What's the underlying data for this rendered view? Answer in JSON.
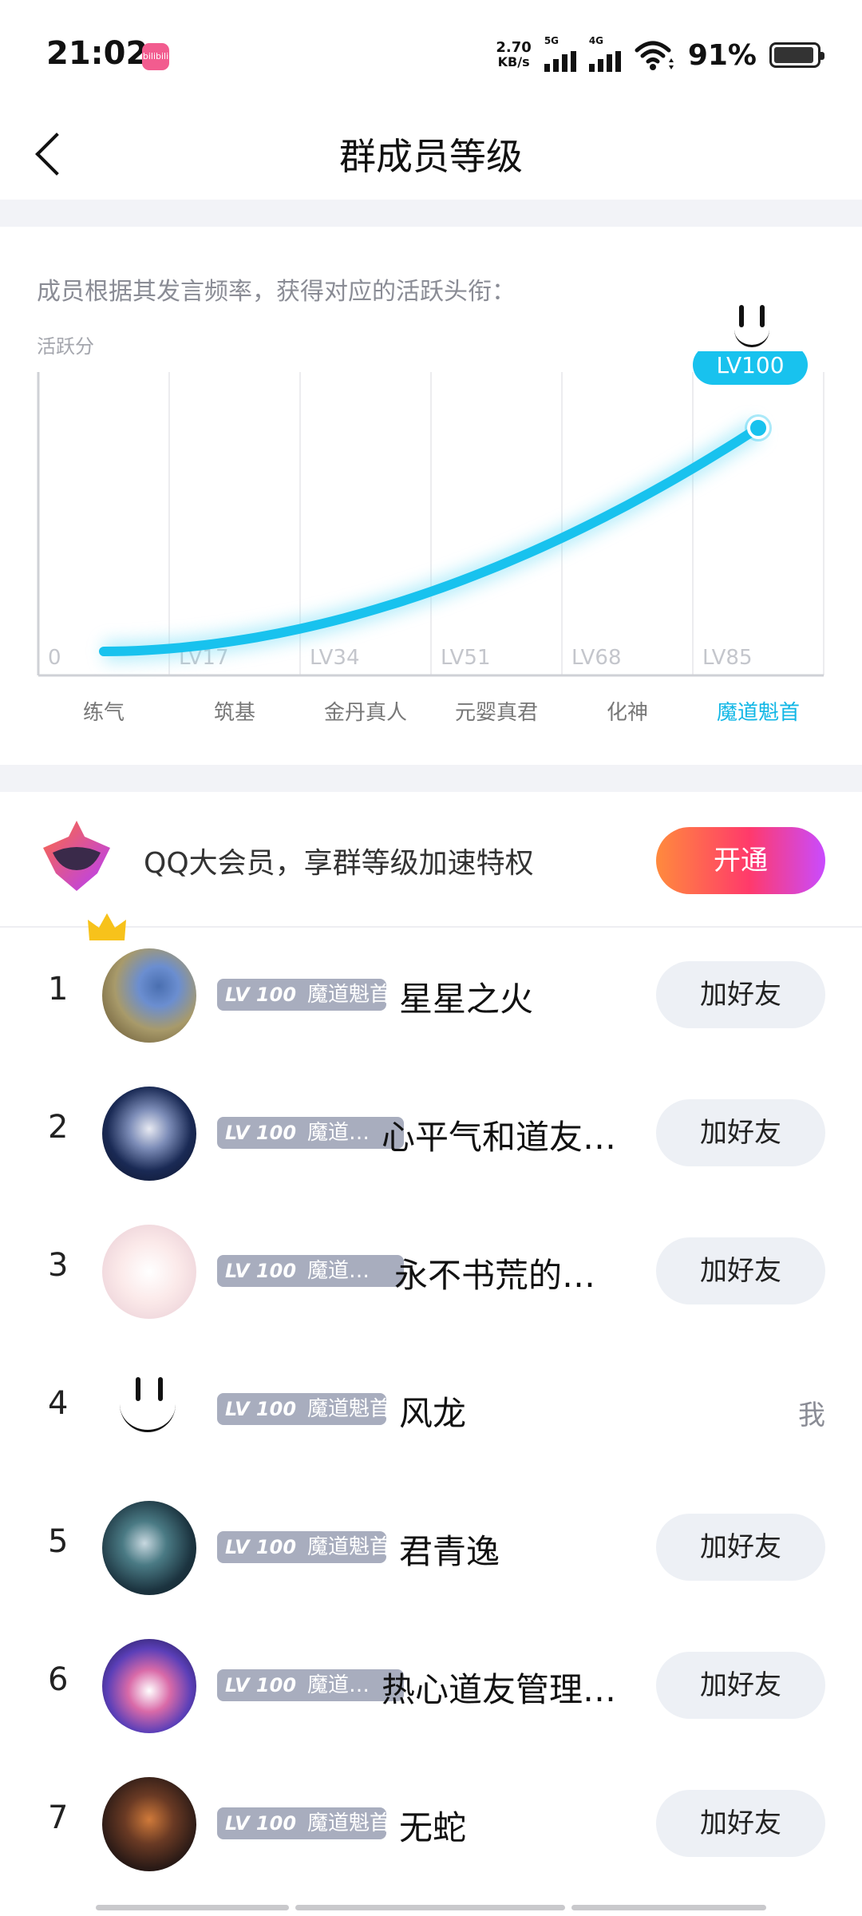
{
  "status_bar": {
    "time": "21:02",
    "app_icon_text": "bilibili",
    "net_speed_value": "2.70",
    "net_speed_unit": "KB/s",
    "sig1_label": "5G",
    "sig2_label": "4G",
    "battery_percent": "91%",
    "battery_level": 0.91
  },
  "header": {
    "title": "群成员等级"
  },
  "chart_intro": "成员根据其发言频率，获得对应的活跃头衔：",
  "chart_data": {
    "type": "line",
    "title": "",
    "ylabel": "活跃分",
    "x": [
      "练气",
      "筑基",
      "金丹真人",
      "元婴真君",
      "化神",
      "魔道魁首"
    ],
    "grid_level_labels": [
      "0",
      "LV17",
      "LV34",
      "LV51",
      "LV68",
      "LV85"
    ],
    "current_level_label": "LV100",
    "series": [
      {
        "name": "",
        "values": [
          0,
          17,
          34,
          51,
          68,
          100
        ]
      }
    ],
    "highlighted_category": "魔道魁首",
    "grid": true
  },
  "vip_promo": {
    "text": "QQ大会员，享群等级加速特权",
    "button": "开通"
  },
  "members": [
    {
      "rank": "1",
      "lv": "LV 100",
      "title": "魔道魁首",
      "name": "星星之火",
      "action": "加好友"
    },
    {
      "rank": "2",
      "lv": "LV 100",
      "title": "魔道…",
      "name": "心平气和道友…",
      "action": "加好友"
    },
    {
      "rank": "3",
      "lv": "LV 100",
      "title": "魔道…",
      "name": "永不书荒的…",
      "action": "加好友"
    },
    {
      "rank": "4",
      "lv": "LV 100",
      "title": "魔道魁首",
      "name": "风龙",
      "action": "我"
    },
    {
      "rank": "5",
      "lv": "LV 100",
      "title": "魔道魁首",
      "name": "君青逸",
      "action": "加好友"
    },
    {
      "rank": "6",
      "lv": "LV 100",
      "title": "魔道…",
      "name": "热心道友管理…",
      "action": "加好友"
    },
    {
      "rank": "7",
      "lv": "LV 100",
      "title": "魔道魁首",
      "name": "无蛇",
      "action": "加好友"
    }
  ],
  "colors": {
    "accent": "#12b7e6",
    "badge": "#a8adbe",
    "button_bg": "#edf0f5"
  }
}
